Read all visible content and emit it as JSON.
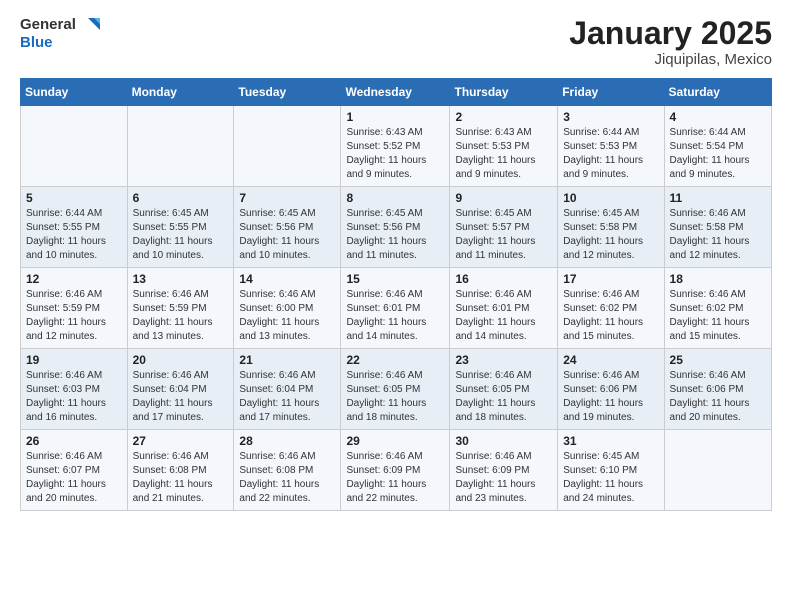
{
  "header": {
    "logo_line1": "General",
    "logo_line2": "Blue",
    "month_title": "January 2025",
    "location": "Jiquipilas, Mexico"
  },
  "weekdays": [
    "Sunday",
    "Monday",
    "Tuesday",
    "Wednesday",
    "Thursday",
    "Friday",
    "Saturday"
  ],
  "weeks": [
    [
      {
        "day": "",
        "sunrise": "",
        "sunset": "",
        "daylight": ""
      },
      {
        "day": "",
        "sunrise": "",
        "sunset": "",
        "daylight": ""
      },
      {
        "day": "",
        "sunrise": "",
        "sunset": "",
        "daylight": ""
      },
      {
        "day": "1",
        "sunrise": "Sunrise: 6:43 AM",
        "sunset": "Sunset: 5:52 PM",
        "daylight": "Daylight: 11 hours and 9 minutes."
      },
      {
        "day": "2",
        "sunrise": "Sunrise: 6:43 AM",
        "sunset": "Sunset: 5:53 PM",
        "daylight": "Daylight: 11 hours and 9 minutes."
      },
      {
        "day": "3",
        "sunrise": "Sunrise: 6:44 AM",
        "sunset": "Sunset: 5:53 PM",
        "daylight": "Daylight: 11 hours and 9 minutes."
      },
      {
        "day": "4",
        "sunrise": "Sunrise: 6:44 AM",
        "sunset": "Sunset: 5:54 PM",
        "daylight": "Daylight: 11 hours and 9 minutes."
      }
    ],
    [
      {
        "day": "5",
        "sunrise": "Sunrise: 6:44 AM",
        "sunset": "Sunset: 5:55 PM",
        "daylight": "Daylight: 11 hours and 10 minutes."
      },
      {
        "day": "6",
        "sunrise": "Sunrise: 6:45 AM",
        "sunset": "Sunset: 5:55 PM",
        "daylight": "Daylight: 11 hours and 10 minutes."
      },
      {
        "day": "7",
        "sunrise": "Sunrise: 6:45 AM",
        "sunset": "Sunset: 5:56 PM",
        "daylight": "Daylight: 11 hours and 10 minutes."
      },
      {
        "day": "8",
        "sunrise": "Sunrise: 6:45 AM",
        "sunset": "Sunset: 5:56 PM",
        "daylight": "Daylight: 11 hours and 11 minutes."
      },
      {
        "day": "9",
        "sunrise": "Sunrise: 6:45 AM",
        "sunset": "Sunset: 5:57 PM",
        "daylight": "Daylight: 11 hours and 11 minutes."
      },
      {
        "day": "10",
        "sunrise": "Sunrise: 6:45 AM",
        "sunset": "Sunset: 5:58 PM",
        "daylight": "Daylight: 11 hours and 12 minutes."
      },
      {
        "day": "11",
        "sunrise": "Sunrise: 6:46 AM",
        "sunset": "Sunset: 5:58 PM",
        "daylight": "Daylight: 11 hours and 12 minutes."
      }
    ],
    [
      {
        "day": "12",
        "sunrise": "Sunrise: 6:46 AM",
        "sunset": "Sunset: 5:59 PM",
        "daylight": "Daylight: 11 hours and 12 minutes."
      },
      {
        "day": "13",
        "sunrise": "Sunrise: 6:46 AM",
        "sunset": "Sunset: 5:59 PM",
        "daylight": "Daylight: 11 hours and 13 minutes."
      },
      {
        "day": "14",
        "sunrise": "Sunrise: 6:46 AM",
        "sunset": "Sunset: 6:00 PM",
        "daylight": "Daylight: 11 hours and 13 minutes."
      },
      {
        "day": "15",
        "sunrise": "Sunrise: 6:46 AM",
        "sunset": "Sunset: 6:01 PM",
        "daylight": "Daylight: 11 hours and 14 minutes."
      },
      {
        "day": "16",
        "sunrise": "Sunrise: 6:46 AM",
        "sunset": "Sunset: 6:01 PM",
        "daylight": "Daylight: 11 hours and 14 minutes."
      },
      {
        "day": "17",
        "sunrise": "Sunrise: 6:46 AM",
        "sunset": "Sunset: 6:02 PM",
        "daylight": "Daylight: 11 hours and 15 minutes."
      },
      {
        "day": "18",
        "sunrise": "Sunrise: 6:46 AM",
        "sunset": "Sunset: 6:02 PM",
        "daylight": "Daylight: 11 hours and 15 minutes."
      }
    ],
    [
      {
        "day": "19",
        "sunrise": "Sunrise: 6:46 AM",
        "sunset": "Sunset: 6:03 PM",
        "daylight": "Daylight: 11 hours and 16 minutes."
      },
      {
        "day": "20",
        "sunrise": "Sunrise: 6:46 AM",
        "sunset": "Sunset: 6:04 PM",
        "daylight": "Daylight: 11 hours and 17 minutes."
      },
      {
        "day": "21",
        "sunrise": "Sunrise: 6:46 AM",
        "sunset": "Sunset: 6:04 PM",
        "daylight": "Daylight: 11 hours and 17 minutes."
      },
      {
        "day": "22",
        "sunrise": "Sunrise: 6:46 AM",
        "sunset": "Sunset: 6:05 PM",
        "daylight": "Daylight: 11 hours and 18 minutes."
      },
      {
        "day": "23",
        "sunrise": "Sunrise: 6:46 AM",
        "sunset": "Sunset: 6:05 PM",
        "daylight": "Daylight: 11 hours and 18 minutes."
      },
      {
        "day": "24",
        "sunrise": "Sunrise: 6:46 AM",
        "sunset": "Sunset: 6:06 PM",
        "daylight": "Daylight: 11 hours and 19 minutes."
      },
      {
        "day": "25",
        "sunrise": "Sunrise: 6:46 AM",
        "sunset": "Sunset: 6:06 PM",
        "daylight": "Daylight: 11 hours and 20 minutes."
      }
    ],
    [
      {
        "day": "26",
        "sunrise": "Sunrise: 6:46 AM",
        "sunset": "Sunset: 6:07 PM",
        "daylight": "Daylight: 11 hours and 20 minutes."
      },
      {
        "day": "27",
        "sunrise": "Sunrise: 6:46 AM",
        "sunset": "Sunset: 6:08 PM",
        "daylight": "Daylight: 11 hours and 21 minutes."
      },
      {
        "day": "28",
        "sunrise": "Sunrise: 6:46 AM",
        "sunset": "Sunset: 6:08 PM",
        "daylight": "Daylight: 11 hours and 22 minutes."
      },
      {
        "day": "29",
        "sunrise": "Sunrise: 6:46 AM",
        "sunset": "Sunset: 6:09 PM",
        "daylight": "Daylight: 11 hours and 22 minutes."
      },
      {
        "day": "30",
        "sunrise": "Sunrise: 6:46 AM",
        "sunset": "Sunset: 6:09 PM",
        "daylight": "Daylight: 11 hours and 23 minutes."
      },
      {
        "day": "31",
        "sunrise": "Sunrise: 6:45 AM",
        "sunset": "Sunset: 6:10 PM",
        "daylight": "Daylight: 11 hours and 24 minutes."
      },
      {
        "day": "",
        "sunrise": "",
        "sunset": "",
        "daylight": ""
      }
    ]
  ]
}
